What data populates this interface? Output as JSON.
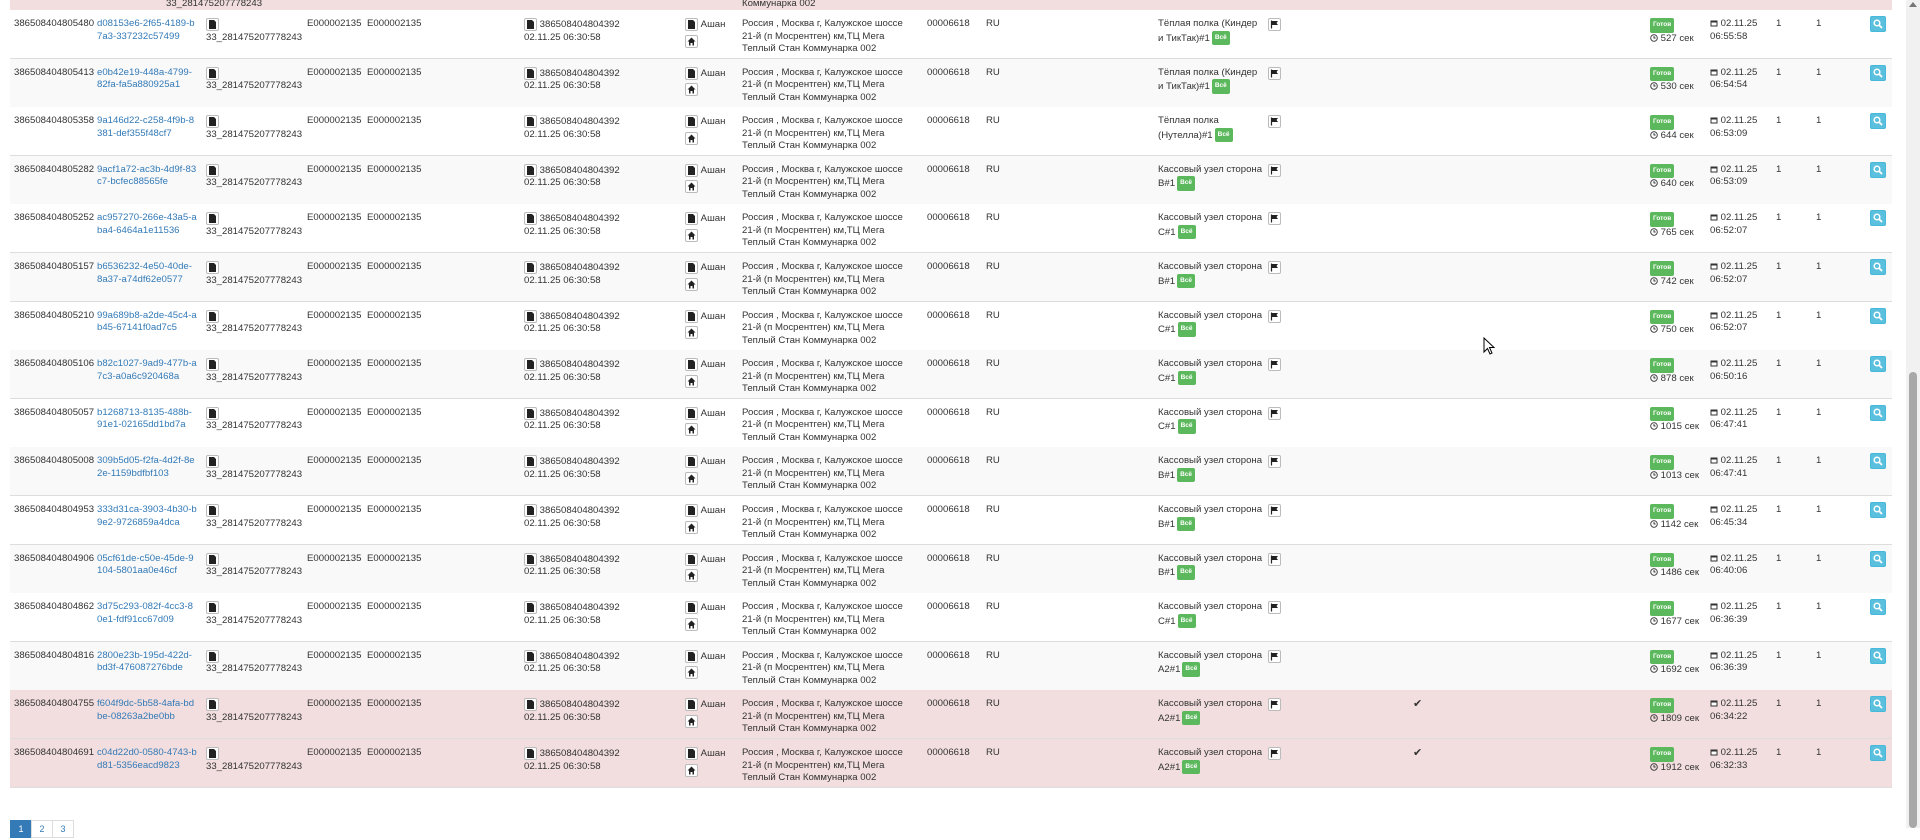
{
  "top_row": {
    "barcode": "33_281475207778243",
    "address_tail": "Коммунарка 002"
  },
  "common": {
    "barcode": "33_281475207778243",
    "code_a": "E000002135",
    "code_b": "E000002135",
    "ref_number": "386508404804392",
    "ref_datetime": "02.11.25 06:30:58",
    "store": "Ашан",
    "address": "Россия , Москва г, Калужское шоссе 21-й (п Мосрентген) км,ТЦ Мега Теплый Стан Коммунарка 002",
    "store_code": "00006618",
    "country": "RU",
    "status": "Готов",
    "date": "02.11.25",
    "qty1": "1",
    "qty2": "1",
    "sec_suffix": "сек"
  },
  "colors": {
    "danger_row": "#f2dede",
    "link": "#337ab7",
    "badge_green": "#5cb85c",
    "search_btn": "#5bc0de"
  },
  "rows": [
    {
      "id": "386508404805480",
      "guid": "d08153e6-2f65-4189-b7a3-337232c57499",
      "item": "Тёплая полка (Киндер и ТикТак)#1",
      "badge": "Всё",
      "secs": "527",
      "time": "06:55:58",
      "checked": "",
      "danger": false
    },
    {
      "id": "386508404805413",
      "guid": "e0b42e19-448a-4799-82fa-fa5a880925a1",
      "item": "Тёплая полка (Киндер и ТикТак)#1",
      "badge": "Всё",
      "secs": "530",
      "time": "06:54:54",
      "checked": "",
      "danger": false
    },
    {
      "id": "386508404805358",
      "guid": "9a146d22-c258-4f9b-8381-def355f48cf7",
      "item": "Тёплая полка (Нутелла)#1",
      "badge": "Всё",
      "secs": "644",
      "time": "06:53:09",
      "checked": "",
      "danger": false
    },
    {
      "id": "386508404805282",
      "guid": "9acf1a72-ac3b-4d9f-83c7-bcfec88565fe",
      "item": "Кассовый узел сторона В#1",
      "badge": "Всё",
      "secs": "640",
      "time": "06:53:09",
      "checked": "",
      "danger": false
    },
    {
      "id": "386508404805252",
      "guid": "ac957270-266e-43a5-aba4-6464a1e11536",
      "item": "Кассовый узел сторона С#1",
      "badge": "Всё",
      "secs": "765",
      "time": "06:52:07",
      "checked": "",
      "danger": false
    },
    {
      "id": "386508404805157",
      "guid": "b6536232-4e50-40de-8a37-a74df62e0577",
      "item": "Кассовый узел сторона В#1",
      "badge": "Всё",
      "secs": "742",
      "time": "06:52:07",
      "checked": "",
      "danger": false
    },
    {
      "id": "386508404805210",
      "guid": "99a689b8-a2de-45c4-ab45-67141f0ad7c5",
      "item": "Кассовый узел сторона С#1",
      "badge": "Всё",
      "secs": "750",
      "time": "06:52:07",
      "checked": "",
      "danger": false
    },
    {
      "id": "386508404805106",
      "guid": "b82c1027-9ad9-477b-a7c3-a0a6c920468a",
      "item": "Кассовый узел сторона С#1",
      "badge": "Всё",
      "secs": "878",
      "time": "06:50:16",
      "checked": "",
      "danger": false
    },
    {
      "id": "386508404805057",
      "guid": "b1268713-8135-488b-91e1-02165dd1bd7a",
      "item": "Кассовый узел сторона С#1",
      "badge": "Всё",
      "secs": "1015",
      "time": "06:47:41",
      "checked": "",
      "danger": false
    },
    {
      "id": "386508404805008",
      "guid": "309b5d05-f2fa-4d2f-8e2e-1159bdfbf103",
      "item": "Кассовый узел сторона В#1",
      "badge": "Всё",
      "secs": "1013",
      "time": "06:47:41",
      "checked": "",
      "danger": false
    },
    {
      "id": "386508404804953",
      "guid": "333d31ca-3903-4b30-b9e2-9726859a4dca",
      "item": "Кассовый узел сторона В#1",
      "badge": "Всё",
      "secs": "1142",
      "time": "06:45:34",
      "checked": "",
      "danger": false
    },
    {
      "id": "386508404804906",
      "guid": "05cf61de-c50e-45de-9104-5801aa0e46cf",
      "item": "Кассовый узел сторона В#1",
      "badge": "Всё",
      "secs": "1486",
      "time": "06:40:06",
      "checked": "",
      "danger": false
    },
    {
      "id": "386508404804862",
      "guid": "3d75c293-082f-4cc3-80e1-fdf91cc67d09",
      "item": "Кассовый узел сторона С#1",
      "badge": "Всё",
      "secs": "1677",
      "time": "06:36:39",
      "checked": "",
      "danger": false
    },
    {
      "id": "386508404804816",
      "guid": "2800e23b-195d-422d-bd3f-476087276bde",
      "item": "Кассовый узел сторона А2#1",
      "badge": "Всё",
      "secs": "1692",
      "time": "06:36:39",
      "checked": "",
      "danger": false
    },
    {
      "id": "386508404804755",
      "guid": "f604f9dc-5b58-4afa-bdbe-08263a2be0bb",
      "item": "Кассовый узел сторона А2#1",
      "badge": "Всё",
      "secs": "1809",
      "time": "06:34:22",
      "checked": "✔",
      "danger": true
    },
    {
      "id": "386508404804691",
      "guid": "c04d22d0-0580-4743-bd81-5356eacd9823",
      "item": "Кассовый узел сторона А2#1",
      "badge": "Всё",
      "secs": "1912",
      "time": "06:32:33",
      "checked": "✔",
      "danger": true
    }
  ],
  "pagination": [
    "1",
    "2",
    "3"
  ]
}
